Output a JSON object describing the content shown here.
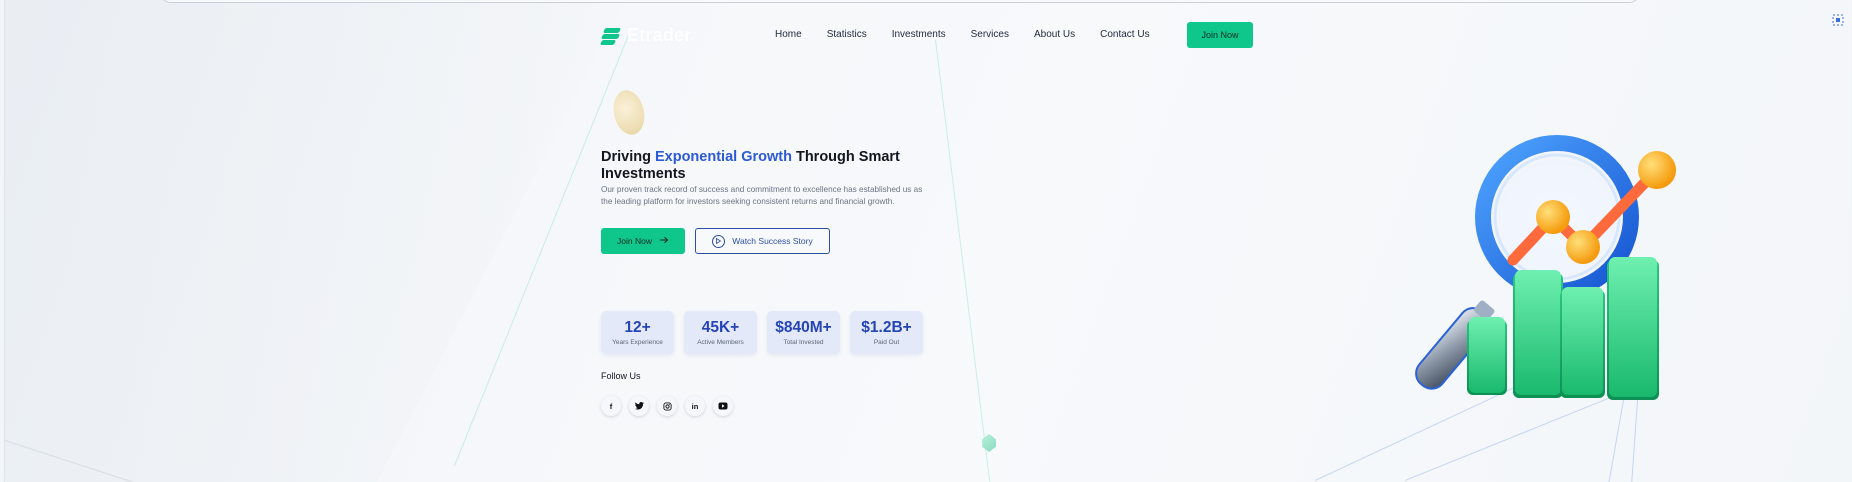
{
  "brand": {
    "name": "Etrader",
    "accent": "#0fc78a",
    "primary_blue": "#2c5ad6"
  },
  "nav": {
    "items": [
      "Home",
      "Statistics",
      "Investments",
      "Services",
      "About Us",
      "Contact Us"
    ],
    "cta_label": "Join Now"
  },
  "hero": {
    "title_prefix": "Driving ",
    "title_accent": "Exponential Growth",
    "title_suffix": " Through Smart Investments",
    "description": "Our proven track record of success and commitment to excellence has established us as the leading platform for investors seeking consistent returns and financial growth.",
    "primary_button": "Join Now",
    "primary_button_icon": "arrow-right-icon",
    "secondary_button": "Watch Success Story",
    "secondary_button_icon": "play-circle-icon"
  },
  "stats": [
    {
      "value": "12+",
      "label": "Years Experience"
    },
    {
      "value": "45K+",
      "label": "Active Members"
    },
    {
      "value": "$840M+",
      "label": "Total Invested"
    },
    {
      "value": "$1.2B+",
      "label": "Paid Out"
    }
  ],
  "follow": {
    "label": "Follow Us",
    "icons": [
      "facebook-icon",
      "twitter-icon",
      "instagram-icon",
      "linkedin-icon",
      "youtube-icon"
    ]
  },
  "illustration": {
    "icon": "growth-chart-magnifier-icon",
    "bar_color": "#2fd58a",
    "ring_color": "#1f6fe0",
    "node_color": "#ffb21a"
  }
}
